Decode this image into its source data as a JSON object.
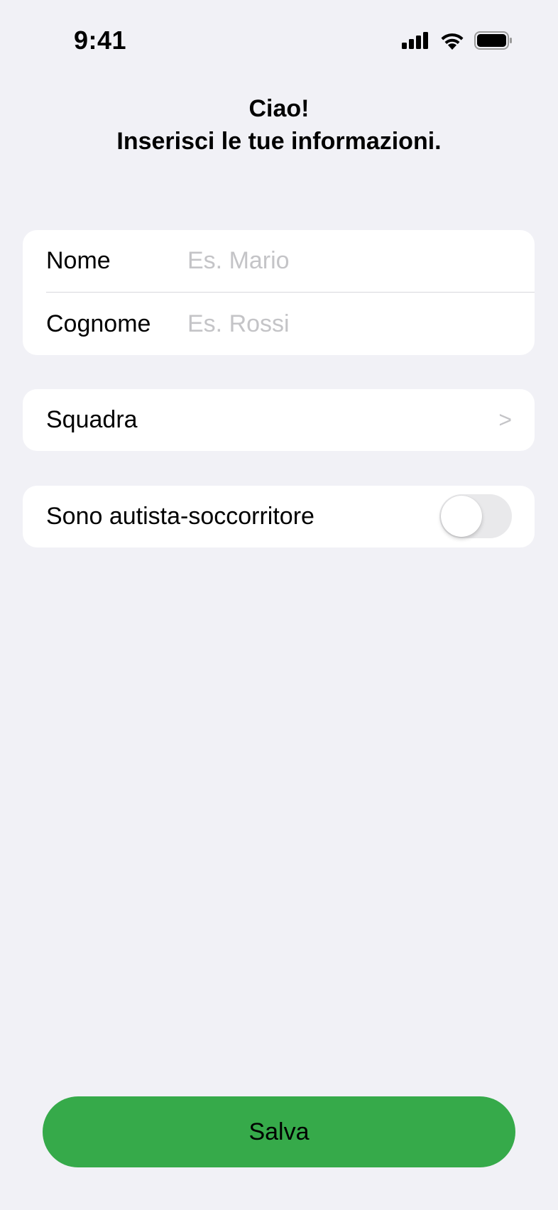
{
  "status_bar": {
    "time": "9:41",
    "icons": [
      "cellular-signal-icon",
      "wifi-icon",
      "battery-icon"
    ]
  },
  "header": {
    "line1": "Ciao!",
    "line2": "Inserisci le tue informazioni."
  },
  "form": {
    "first_name": {
      "label": "Nome",
      "placeholder": "Es. Mario",
      "value": ""
    },
    "last_name": {
      "label": "Cognome",
      "placeholder": "Es. Rossi",
      "value": ""
    },
    "team": {
      "label": "Squadra",
      "chevron": ">"
    },
    "driver": {
      "label": "Sono autista-soccorritore",
      "enabled": false
    }
  },
  "save_button": {
    "label": "Salva"
  },
  "colors": {
    "background": "#f1f1f6",
    "card": "#ffffff",
    "accent": "#36aa4a",
    "placeholder": "#c4c4c7",
    "toggle_off": "#e9e9eb"
  }
}
